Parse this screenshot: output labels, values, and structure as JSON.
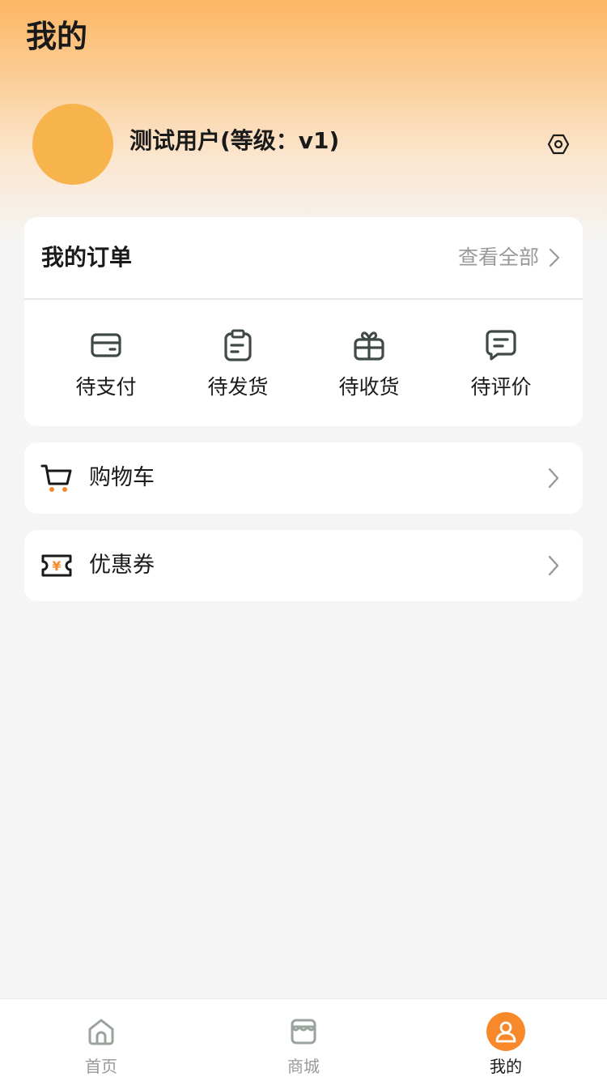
{
  "header": {
    "title": "我的"
  },
  "user": {
    "name": "测试用户(等级：v1)",
    "avatar_color": "#f8b44c"
  },
  "orders": {
    "title": "我的订单",
    "view_all_label": "查看全部",
    "items": [
      {
        "label": "待支付",
        "icon": "wallet-icon"
      },
      {
        "label": "待发货",
        "icon": "clipboard-icon"
      },
      {
        "label": "待收货",
        "icon": "gift-icon"
      },
      {
        "label": "待评价",
        "icon": "comment-icon"
      }
    ]
  },
  "menu": {
    "cart_label": "购物车",
    "coupon_label": "优惠券",
    "coupon_symbol": "¥"
  },
  "tabbar": {
    "tabs": [
      {
        "label": "首页",
        "icon": "home-icon"
      },
      {
        "label": "商城",
        "icon": "store-icon"
      },
      {
        "label": "我的",
        "icon": "user-icon",
        "active": true
      }
    ]
  },
  "colors": {
    "accent": "#f8892b",
    "header_gradient_top": "#fdb663",
    "text_primary": "#1a1a1a",
    "text_secondary": "#999999",
    "icon_dark": "#3f4a44"
  }
}
